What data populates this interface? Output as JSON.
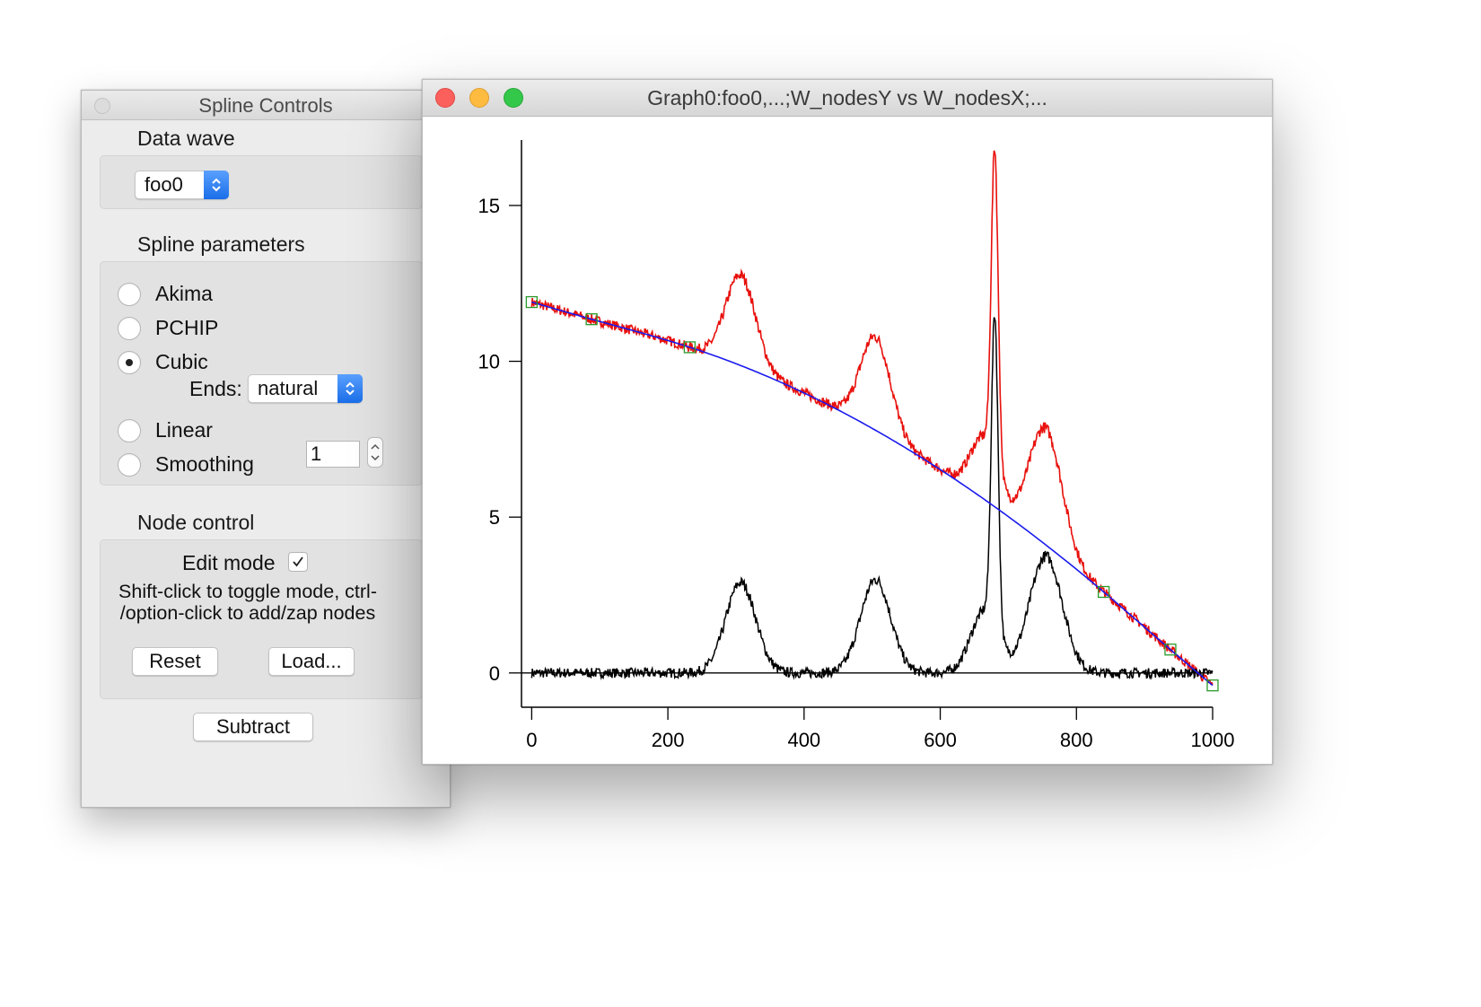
{
  "spline_panel": {
    "title": "Spline Controls",
    "data_wave_label": "Data wave",
    "data_wave_value": "foo0",
    "spline_params_label": "Spline parameters",
    "methods": [
      {
        "label": "Akima",
        "selected": false
      },
      {
        "label": "PCHIP",
        "selected": false
      },
      {
        "label": "Cubic",
        "selected": true
      },
      {
        "label": "Linear",
        "selected": false
      },
      {
        "label": "Smoothing",
        "selected": false
      }
    ],
    "ends_label": "Ends:",
    "ends_value": "natural",
    "smoothing_value": "1",
    "node_control_label": "Node control",
    "edit_mode_label": "Edit mode",
    "edit_mode_checked": true,
    "help_text_line1": "Shift-click to toggle mode, ctrl-",
    "help_text_line2": "/option-click to add/zap nodes",
    "reset_button": "Reset",
    "load_button": "Load...",
    "subtract_button": "Subtract"
  },
  "graph_window": {
    "title": "Graph0:foo0,...;W_nodesY vs W_nodesX;..."
  },
  "chart_data": {
    "type": "line",
    "x_ticks": [
      "0",
      "200",
      "400",
      "600",
      "800",
      "1000"
    ],
    "y_ticks": [
      "0",
      "5",
      "10",
      "15"
    ],
    "xlim": [
      -15,
      1000
    ],
    "ylim": [
      -1.1,
      17.1
    ],
    "baseline": 0,
    "baseline_peaks": [
      {
        "center": 307,
        "height": 2.9,
        "width": 22
      },
      {
        "center": 505,
        "height": 3.0,
        "width": 22
      },
      {
        "center": 665,
        "height": 2.0,
        "width": 20
      },
      {
        "center": 680,
        "height": 10.0,
        "width": 5
      },
      {
        "center": 755,
        "height": 3.75,
        "width": 24
      }
    ],
    "series": [
      {
        "color": "#e8100c",
        "description_points": "data = spline baseline + peaks"
      },
      {
        "color": "#000000",
        "description_points": "subtracted = peaks only"
      },
      {
        "color": "#1a1aee",
        "description_points": "cubic spline through nodes"
      }
    ],
    "spline_nodes": [
      {
        "x": 0,
        "y": 11.9
      },
      {
        "x": 88,
        "y": 11.35
      },
      {
        "x": 232,
        "y": 10.45
      },
      {
        "x": 840,
        "y": 2.6
      },
      {
        "x": 938,
        "y": 0.75
      },
      {
        "x": 1000,
        "y": -0.4
      }
    ],
    "node_color": "#2a9a2a"
  }
}
